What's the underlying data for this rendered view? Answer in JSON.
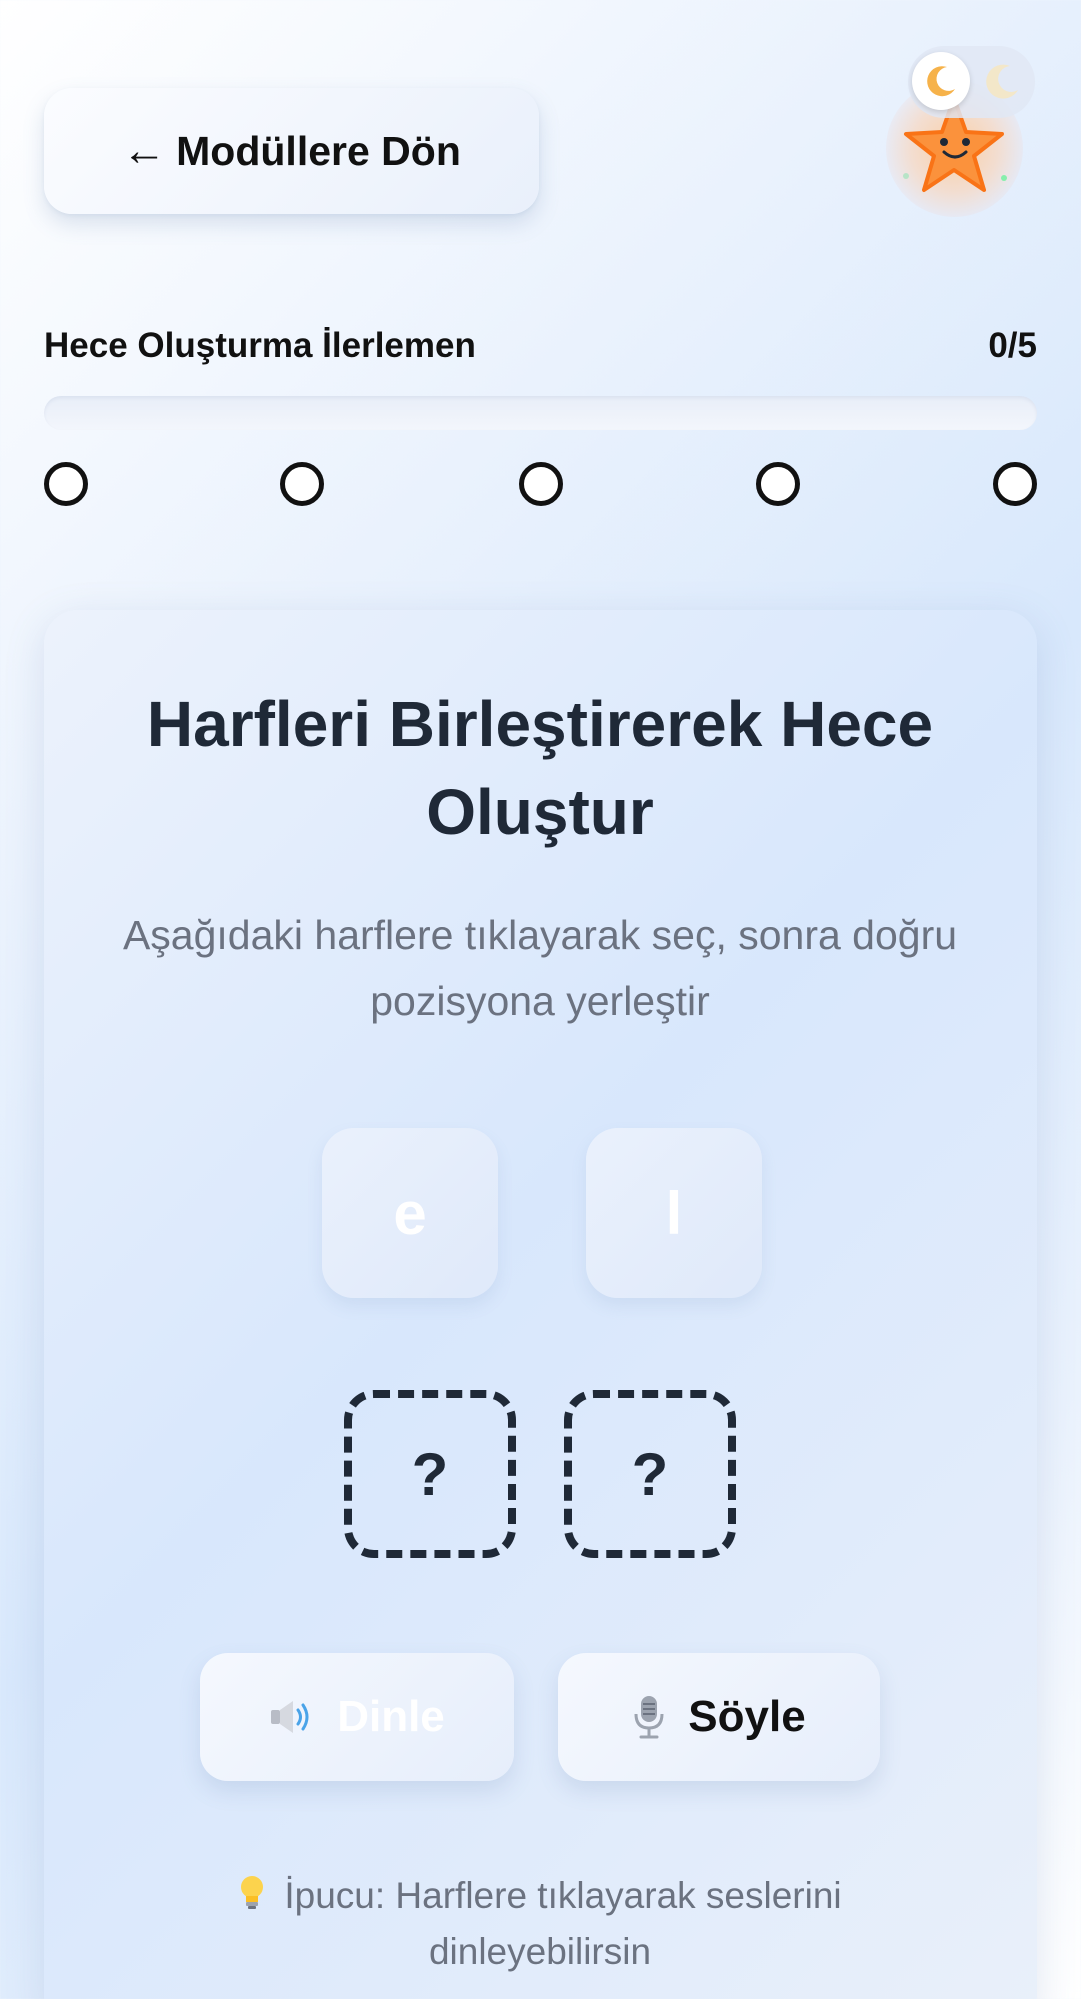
{
  "header": {
    "back_arrow": "←",
    "back_label": "Modüllere Dön"
  },
  "progress": {
    "title": "Hece Oluşturma İlerlemen",
    "count_text": "0/5",
    "completed": 0,
    "total": 5,
    "fraction": 0,
    "steps": [
      "step-1",
      "step-2",
      "step-3",
      "step-4",
      "step-5"
    ]
  },
  "card": {
    "title": "Harfleri Birleştirerek Hece Oluştur",
    "subtitle": "Aşağıdaki harflere tıklayarak seç, sonra doğru pozisyona yerleştir",
    "letters": [
      "e",
      "l"
    ],
    "slots": [
      "?",
      "?"
    ],
    "listen_label": "Dinle",
    "speak_label": "Söyle",
    "hint": "İpucu: Harflere tıklayarak seslerini dinleyebilirsin"
  },
  "icons": {
    "back": "arrow-left-icon",
    "mascot": "star-mascot-icon",
    "theme_light": "moon-icon",
    "theme_dark": "moon-icon",
    "listen": "speaker-icon",
    "speak": "microphone-icon",
    "hint": "lightbulb-icon"
  },
  "colors": {
    "text_dark": "#1f2937",
    "text_muted": "#6b7280",
    "mascot_star": "#f97316",
    "progress_fill": "#7c5cff"
  }
}
